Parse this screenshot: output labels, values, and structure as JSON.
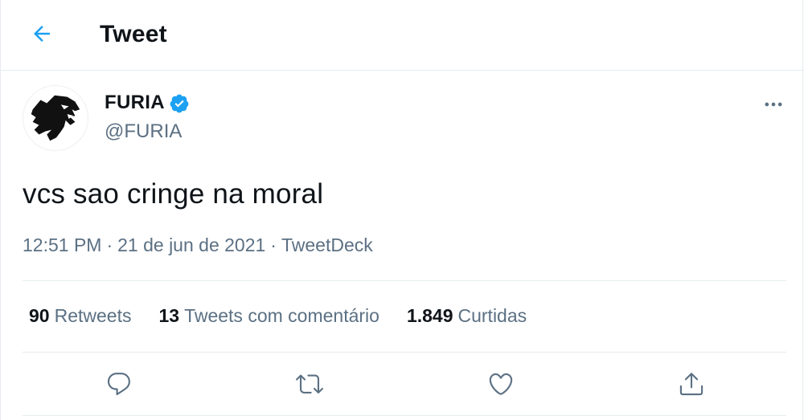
{
  "header": {
    "back_icon": "arrow-left-icon",
    "title": "Tweet"
  },
  "author": {
    "display_name": "FURIA",
    "verified_icon": "verified-badge-icon",
    "handle": "@FURIA",
    "avatar_icon": "panther-logo-icon"
  },
  "tweet": {
    "text": "vcs sao cringe na moral",
    "time": "12:51 PM",
    "date": "21 de jun de 2021",
    "separator": "·",
    "source": "TweetDeck"
  },
  "stats": {
    "retweets_count": "90",
    "retweets_label": "Retweets",
    "quotes_count": "13",
    "quotes_label": "Tweets com comentário",
    "likes_count": "1.849",
    "likes_label": "Curtidas"
  },
  "actions": {
    "reply_icon": "reply-icon",
    "retweet_icon": "retweet-icon",
    "like_icon": "heart-icon",
    "share_icon": "share-icon",
    "more_icon": "more-horizontal-icon"
  },
  "colors": {
    "accent": "#1da1f2",
    "text": "#0f1419",
    "secondary": "#5b7083",
    "border": "#e6ecf0"
  }
}
